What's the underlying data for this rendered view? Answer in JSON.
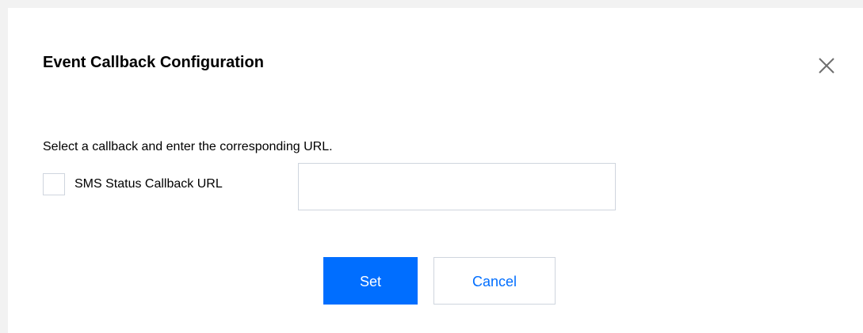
{
  "dialog": {
    "title": "Event Callback Configuration",
    "close_icon": "close-icon",
    "instruction": "Select a callback and enter the corresponding URL.",
    "field": {
      "checkbox_checked": false,
      "label": "SMS Status Callback URL",
      "value": "",
      "placeholder": ""
    },
    "buttons": {
      "set_label": "Set",
      "cancel_label": "Cancel"
    }
  },
  "colors": {
    "primary": "#006eff",
    "border": "#cfd5de",
    "text": "#000000",
    "backdrop": "#f2f2f2"
  }
}
